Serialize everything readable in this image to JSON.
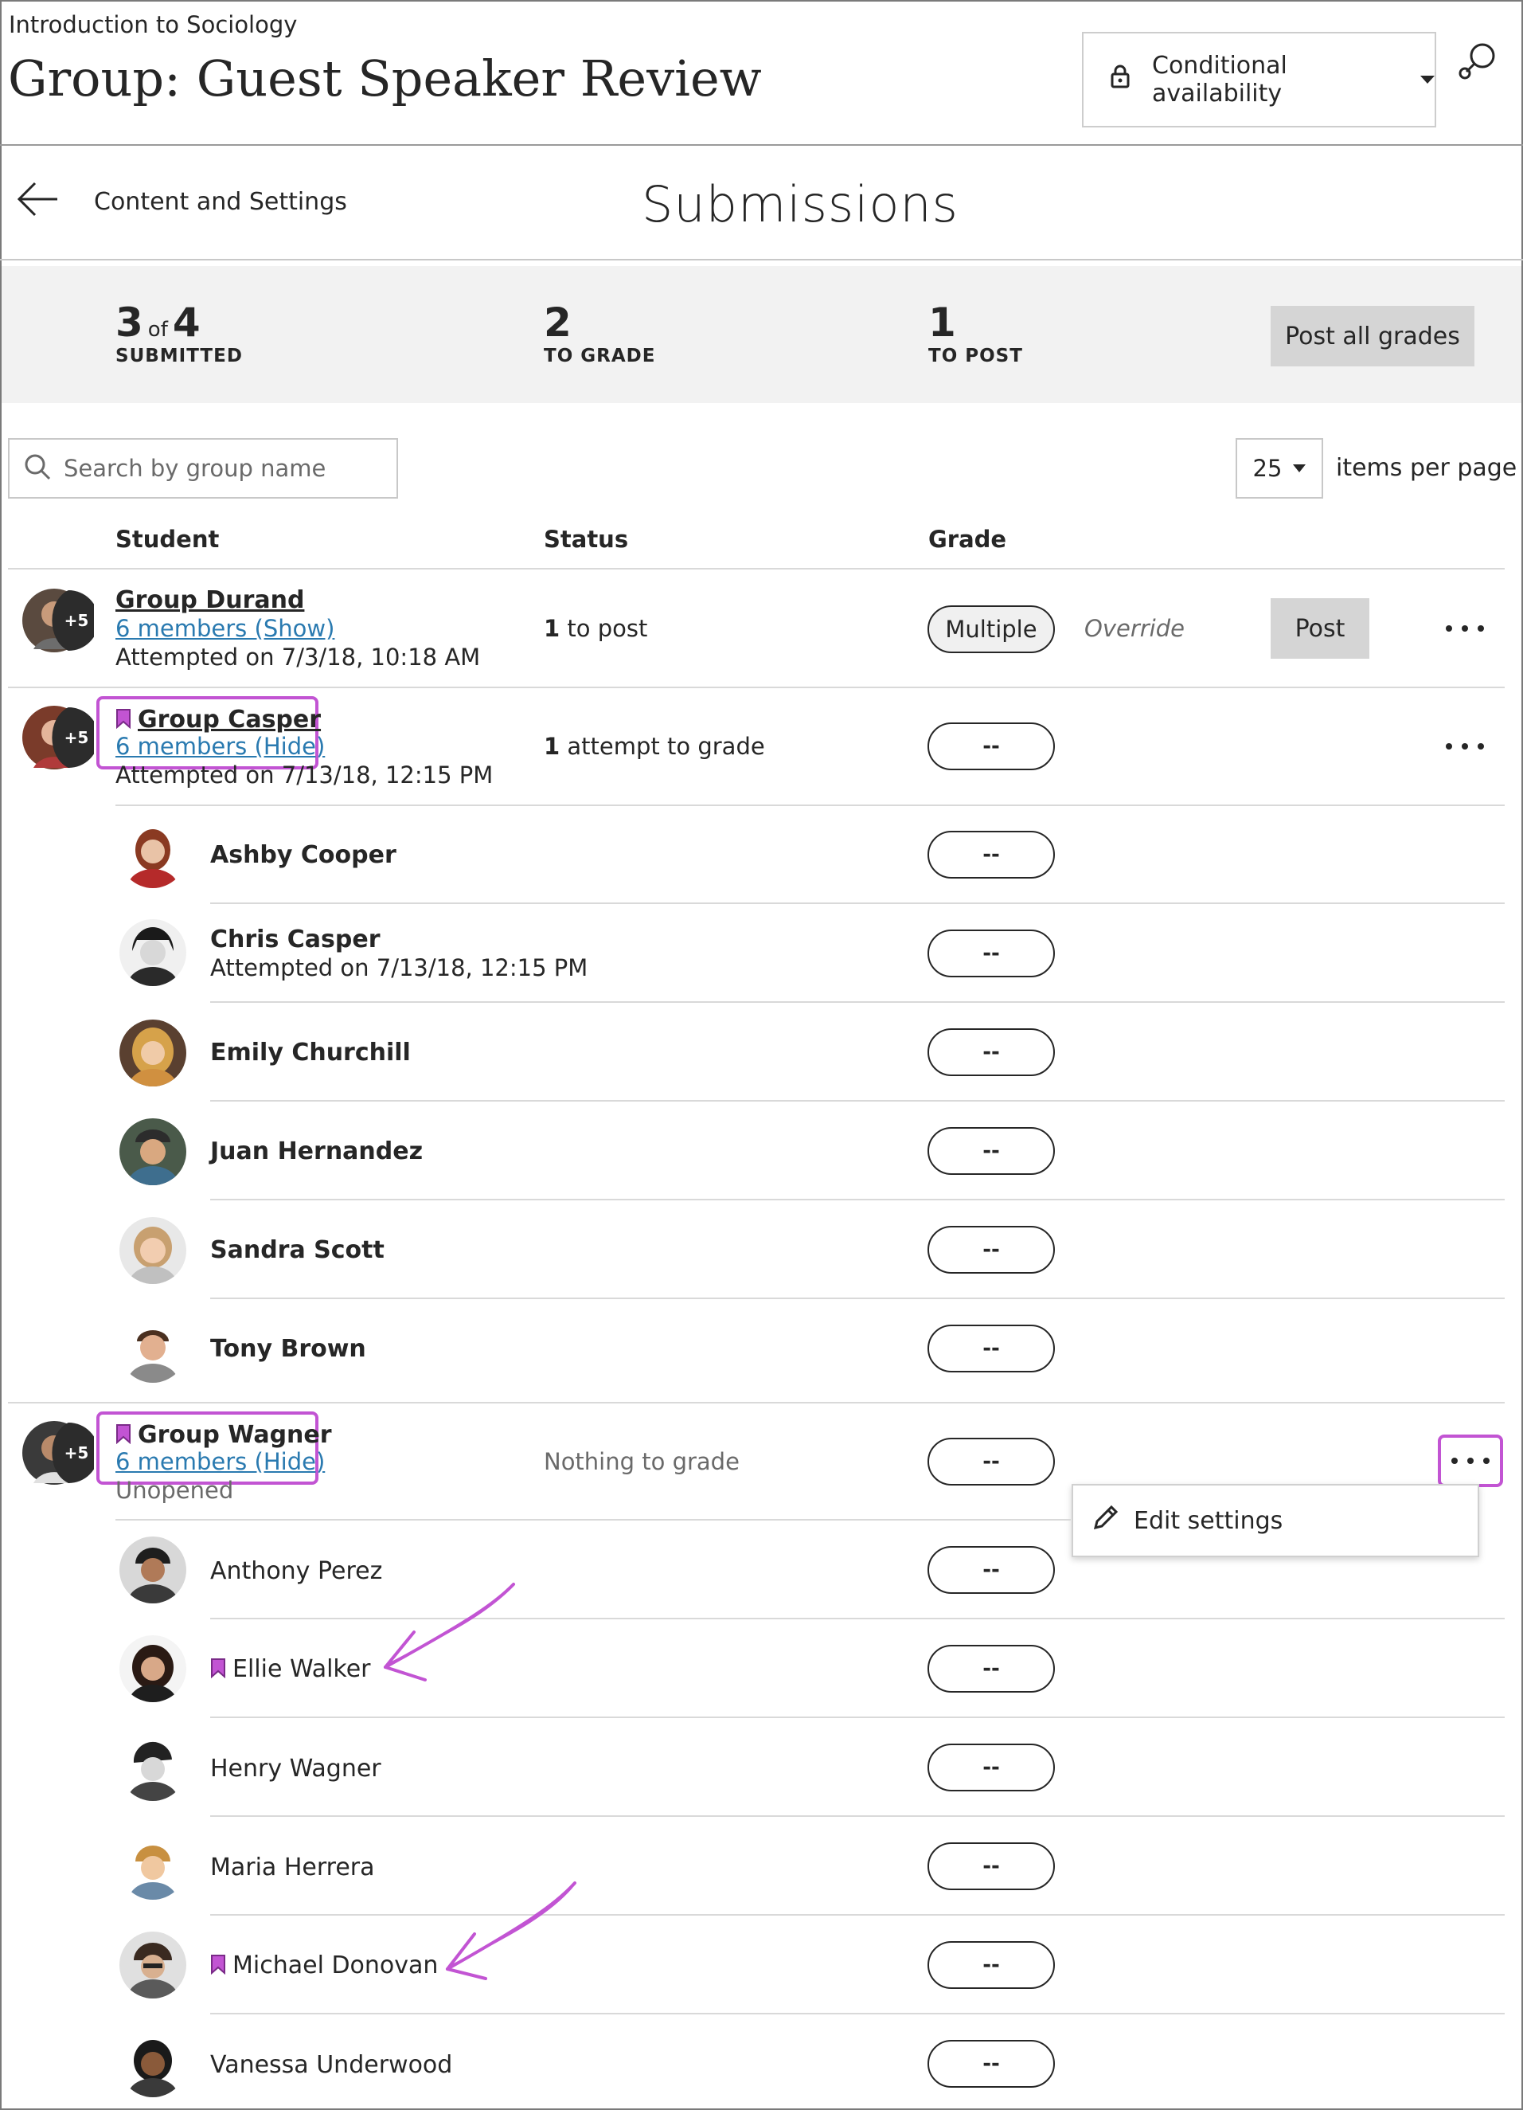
{
  "header": {
    "course": "Introduction to Sociology",
    "title": "Group: Guest Speaker Review",
    "availability_label": "Conditional availability"
  },
  "nav": {
    "back_label": "Content and Settings",
    "page_title": "Submissions"
  },
  "stats": {
    "submitted_count": "3",
    "submitted_of": "of",
    "submitted_total": "4",
    "submitted_label": "SUBMITTED",
    "to_grade_count": "2",
    "to_grade_label": "TO GRADE",
    "to_post_count": "1",
    "to_post_label": "TO POST",
    "post_all_label": "Post all grades"
  },
  "search": {
    "placeholder": "Search by group name"
  },
  "pagination": {
    "per_page": "25",
    "label": "items per page"
  },
  "columns": {
    "student": "Student",
    "status": "Status",
    "grade": "Grade"
  },
  "groups": [
    {
      "avatar_badge": "+5",
      "name": "Group Durand",
      "members": "6 members (Show)",
      "attempt": "Attempted on 7/3/18, 10:18 AM",
      "status_num": "1",
      "status_text": " to post",
      "grade": "Multiple",
      "override": "Override",
      "post_label": "Post"
    },
    {
      "avatar_badge": "+5",
      "name": "Group Casper",
      "members": "6 members (Hide)",
      "attempt": "Attempted on 7/13/18, 12:15 PM",
      "status_num": "1",
      "status_text": " attempt to grade",
      "grade": "--"
    },
    {
      "avatar_badge": "+5",
      "name": "Group Wagner",
      "members": "6 members (Hide)",
      "attempt": "Unopened",
      "status_text": "Nothing to grade",
      "grade": "--"
    }
  ],
  "casper_members": [
    {
      "name": "Ashby Cooper",
      "grade": "--"
    },
    {
      "name": "Chris Casper",
      "sub": "Attempted on 7/13/18, 12:15 PM",
      "grade": "--"
    },
    {
      "name": "Emily Churchill",
      "grade": "--"
    },
    {
      "name": "Juan Hernandez",
      "grade": "--"
    },
    {
      "name": "Sandra Scott",
      "grade": "--"
    },
    {
      "name": "Tony Brown",
      "grade": "--"
    }
  ],
  "wagner_members": [
    {
      "name": "Anthony Perez",
      "grade": "--"
    },
    {
      "name": "Ellie Walker",
      "grade": "--"
    },
    {
      "name": "Henry Wagner",
      "grade": "--"
    },
    {
      "name": "Maria Herrera",
      "grade": "--"
    },
    {
      "name": "Michael Donovan",
      "grade": "--"
    },
    {
      "name": "Vanessa Underwood",
      "grade": "--"
    }
  ],
  "menu": {
    "edit_settings": "Edit settings"
  },
  "colors": {
    "highlight": "#c254d3",
    "link": "#2a7ab0",
    "button_gray": "#d5d5d5"
  }
}
